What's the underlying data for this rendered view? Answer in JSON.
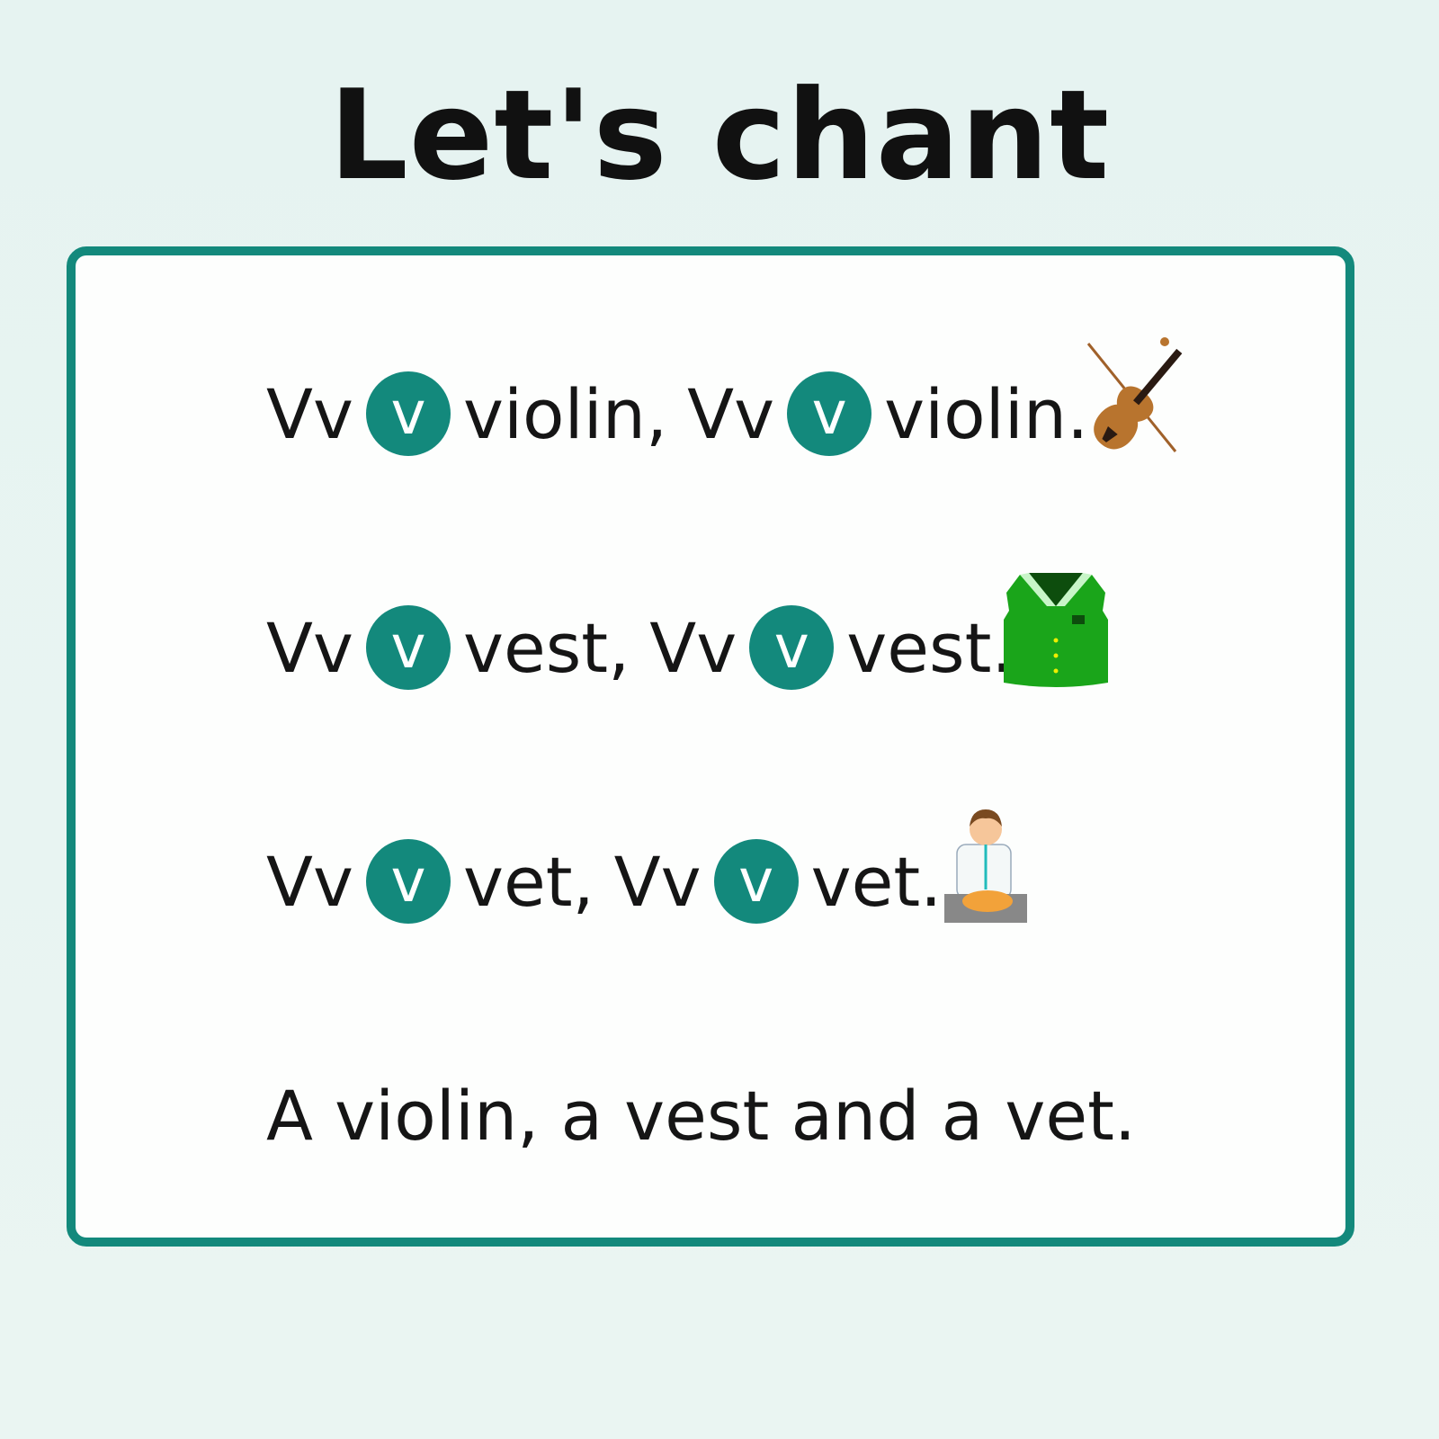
{
  "title": "Let's chant",
  "accent_color": "#13897c",
  "lines": [
    {
      "prefix": "Vv",
      "letter": "v",
      "word": "violin,",
      "prefix2": "Vv",
      "letter2": "v",
      "word2": "violin.",
      "icon": "violin-icon"
    },
    {
      "prefix": "Vv",
      "letter": "v",
      "word": "vest,",
      "prefix2": "Vv",
      "letter2": "v",
      "word2": "vest.",
      "icon": "vest-icon"
    },
    {
      "prefix": "Vv",
      "letter": "v",
      "word": "vet,",
      "prefix2": "Vv",
      "letter2": "v",
      "word2": "vet.",
      "icon": "vet-icon"
    }
  ],
  "summary": "A violin, a vest and a vet."
}
